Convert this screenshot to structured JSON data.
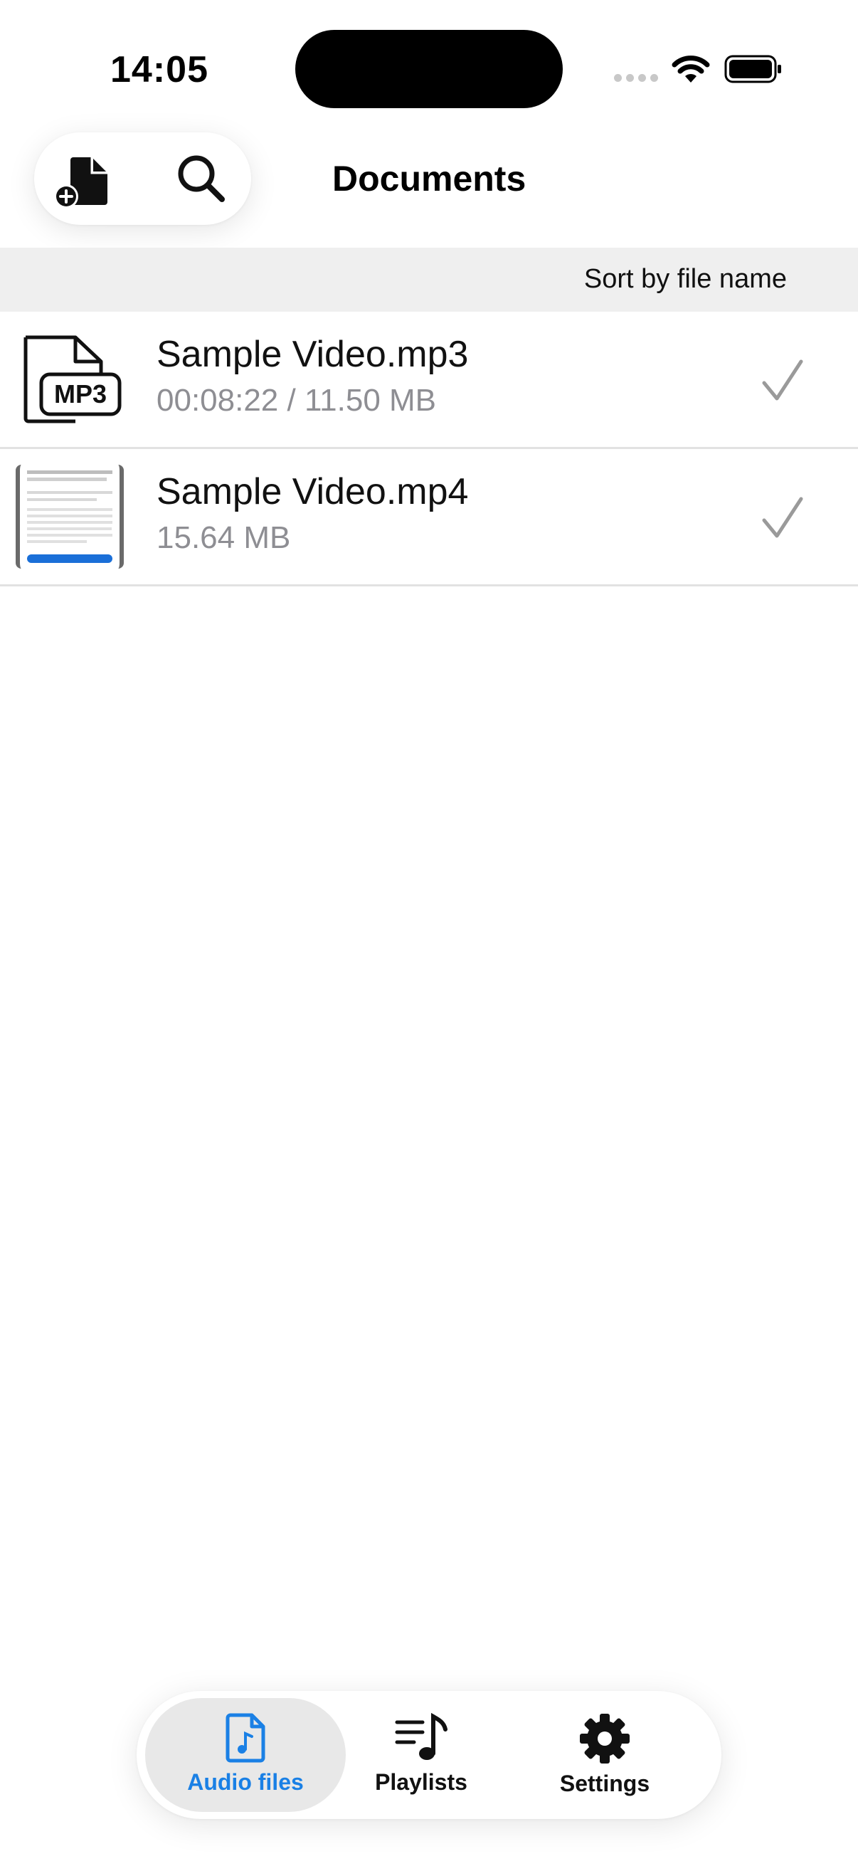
{
  "status_bar": {
    "time": "14:05"
  },
  "header": {
    "title": "Documents"
  },
  "sort": {
    "label": "Sort by file name"
  },
  "files": [
    {
      "name": "Sample Video.mp3",
      "meta": "00:08:22 / 11.50 MB",
      "thumb_badge": "MP3"
    },
    {
      "name": "Sample Video.mp4",
      "meta": "15.64 MB"
    }
  ],
  "tabs": [
    {
      "label": "Audio files",
      "active": true
    },
    {
      "label": "Playlists",
      "active": false
    },
    {
      "label": "Settings",
      "active": false
    }
  ],
  "colors": {
    "accent": "#1a80e5",
    "sort_bar_bg": "#efefef",
    "meta_text": "#8e8e93"
  }
}
